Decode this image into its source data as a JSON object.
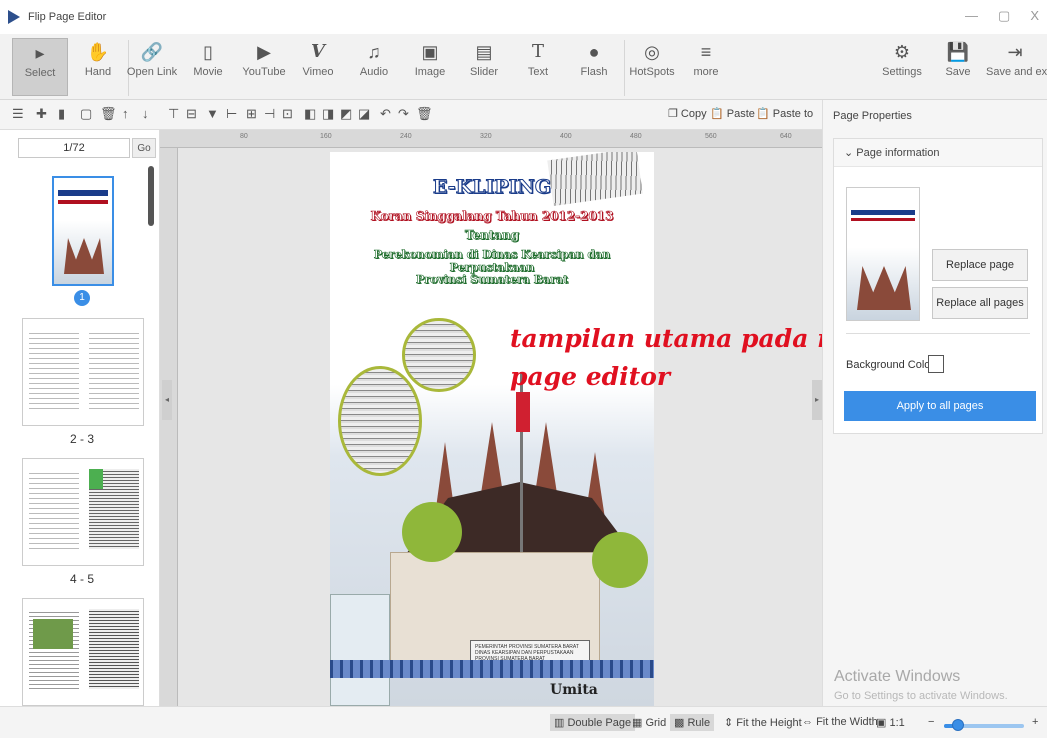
{
  "window": {
    "title": "Flip Page Editor",
    "restore_glyph": "▢",
    "close_glyph": "X"
  },
  "toolbar": {
    "items": [
      {
        "label": "Select",
        "icon": "▸"
      },
      {
        "label": "Hand",
        "icon": "✋"
      },
      {
        "label": "Open Link",
        "icon": "🔗"
      },
      {
        "label": "Movie",
        "icon": "▯"
      },
      {
        "label": "YouTube",
        "icon": "▶"
      },
      {
        "label": "Vimeo",
        "icon": "V"
      },
      {
        "label": "Audio",
        "icon": "♫"
      },
      {
        "label": "Image",
        "icon": "▣"
      },
      {
        "label": "Slider",
        "icon": "▤"
      },
      {
        "label": "Text",
        "icon": "T"
      },
      {
        "label": "Flash",
        "icon": "●"
      },
      {
        "label": "HotSpots",
        "icon": "◎"
      },
      {
        "label": "more",
        "icon": "≡"
      },
      {
        "label": "Settings",
        "icon": "⚙"
      },
      {
        "label": "Save",
        "icon": "💾"
      },
      {
        "label": "Save and exit",
        "icon": "⇥"
      }
    ]
  },
  "subbar": {
    "copy": "Copy",
    "paste": "Paste",
    "paste_to": "Paste to"
  },
  "pages_panel": {
    "page_input": "1/72",
    "go": "Go",
    "selected_badge": "1",
    "labels": [
      "2 - 3",
      "4 - 5"
    ]
  },
  "ruler": {
    "ticks": [
      "80",
      "160",
      "240",
      "320",
      "400",
      "480",
      "560",
      "640"
    ]
  },
  "cover": {
    "title": "E-KLIPING",
    "line2": "Koran Singgalang Tahun 2012-2013",
    "line3": "Tentang",
    "line4": "Perekonomian di Dinas Kearsipan dan Perpustakaan",
    "line5": "Provinsi Sumatera Barat",
    "sign1": "PEMERINTAH PROVINSI SUMATERA BARAT",
    "sign2": "DINAS KEARSIPAN DAN PERPUSTAKAAN",
    "sign3": "PROVINSI SUMATERA BARAT",
    "author": "Umita"
  },
  "overlay": {
    "line1": "tampilan utama pada menu",
    "line2": "page editor",
    "color": "#e01020"
  },
  "properties": {
    "title": "Page Properties",
    "section": "Page information",
    "replace_page": "Replace page",
    "replace_all": "Replace all pages",
    "bg_color_label": "Background Color",
    "apply_all": "Apply to all pages"
  },
  "watermark": {
    "line1": "Activate Windows",
    "line2": "Go to Settings to activate Windows."
  },
  "statusbar": {
    "double_page": "Double Page",
    "grid": "Grid",
    "rule": "Rule",
    "fit_height": "Fit the Height",
    "fit_width": "Fit the Width",
    "ratio": "1:1",
    "zoom_fraction": 0.18
  },
  "accent_color": "#3a8ee6"
}
